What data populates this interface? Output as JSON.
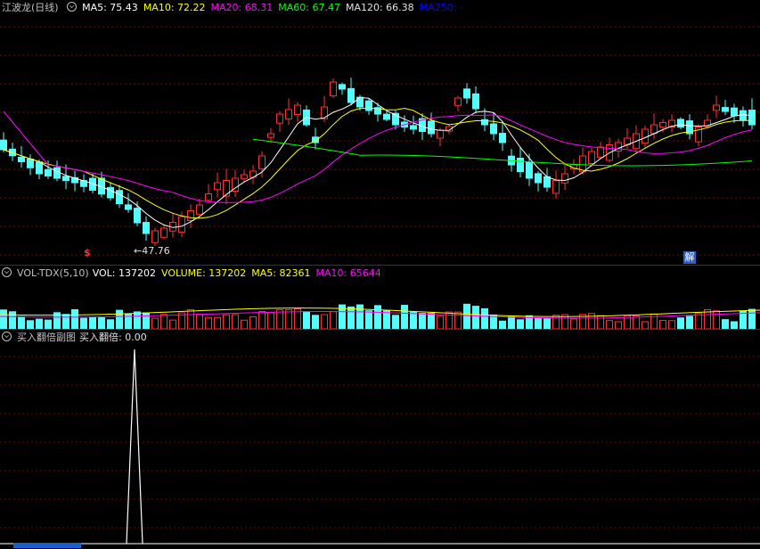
{
  "main": {
    "stock_name": "江波龙(日线)",
    "ma_items": [
      {
        "label": "MA5: 75.43",
        "color": "#ffffff"
      },
      {
        "label": "MA10: 72.22",
        "color": "#ffff00"
      },
      {
        "label": "MA20: 68.31",
        "color": "#ff00ff"
      },
      {
        "label": "MA60: 67.47",
        "color": "#00ff00"
      },
      {
        "label": "MA120: 66.38",
        "color": "#e0e0e0"
      },
      {
        "label": "MA250: -",
        "color": "#0000ff"
      }
    ],
    "low_price_label": "←47.76",
    "sell_flag": "解",
    "buy_flag": "$"
  },
  "volume": {
    "indicator": "VOL-TDX(5,10)",
    "items": [
      {
        "label": "VOL: 137202",
        "color": "#ffffff"
      },
      {
        "label": "VOLUME: 137202",
        "color": "#ffff00"
      },
      {
        "label": "MA5: 82361",
        "color": "#ffff00"
      },
      {
        "label": "MA10: 65644",
        "color": "#ff00ff"
      }
    ]
  },
  "indicator": {
    "name": "买入翻倍副图",
    "value_label": "买入翻倍: 0.00"
  },
  "colors": {
    "up": "#ff3030",
    "down": "#54fcfc",
    "grid": "#7a0000",
    "ma5": "#ffffff",
    "ma10": "#ffff00",
    "ma20": "#ff00ff",
    "ma60": "#00ff00"
  }
}
